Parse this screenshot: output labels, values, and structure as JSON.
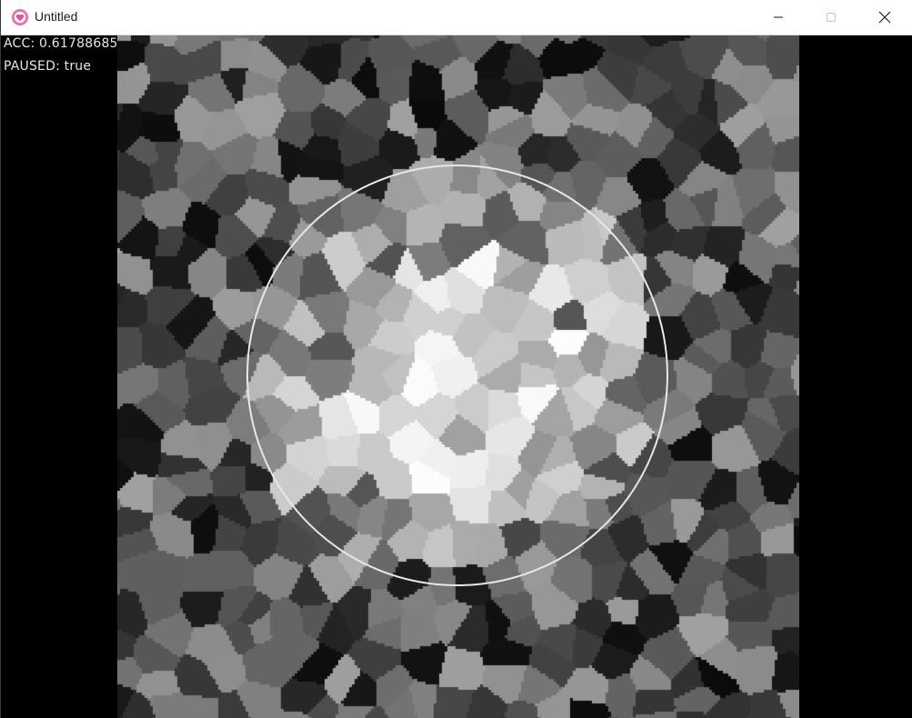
{
  "window": {
    "title": "Untitled",
    "icons": {
      "app": "app-heart-icon",
      "minimize": "minimize-icon",
      "maximize": "maximize-icon",
      "close": "close-icon"
    }
  },
  "hud": {
    "acc_text": "ACC: 0.61788685",
    "paused_text": "PAUSED: true"
  },
  "colors": {
    "titlebar": "#ffffff",
    "background": "#000000",
    "hud_text": "#e6e6e6",
    "ring": "#e8e8e8",
    "app_icon_ring": "#e94fa0",
    "app_icon_fill": "#7fd0f5"
  }
}
